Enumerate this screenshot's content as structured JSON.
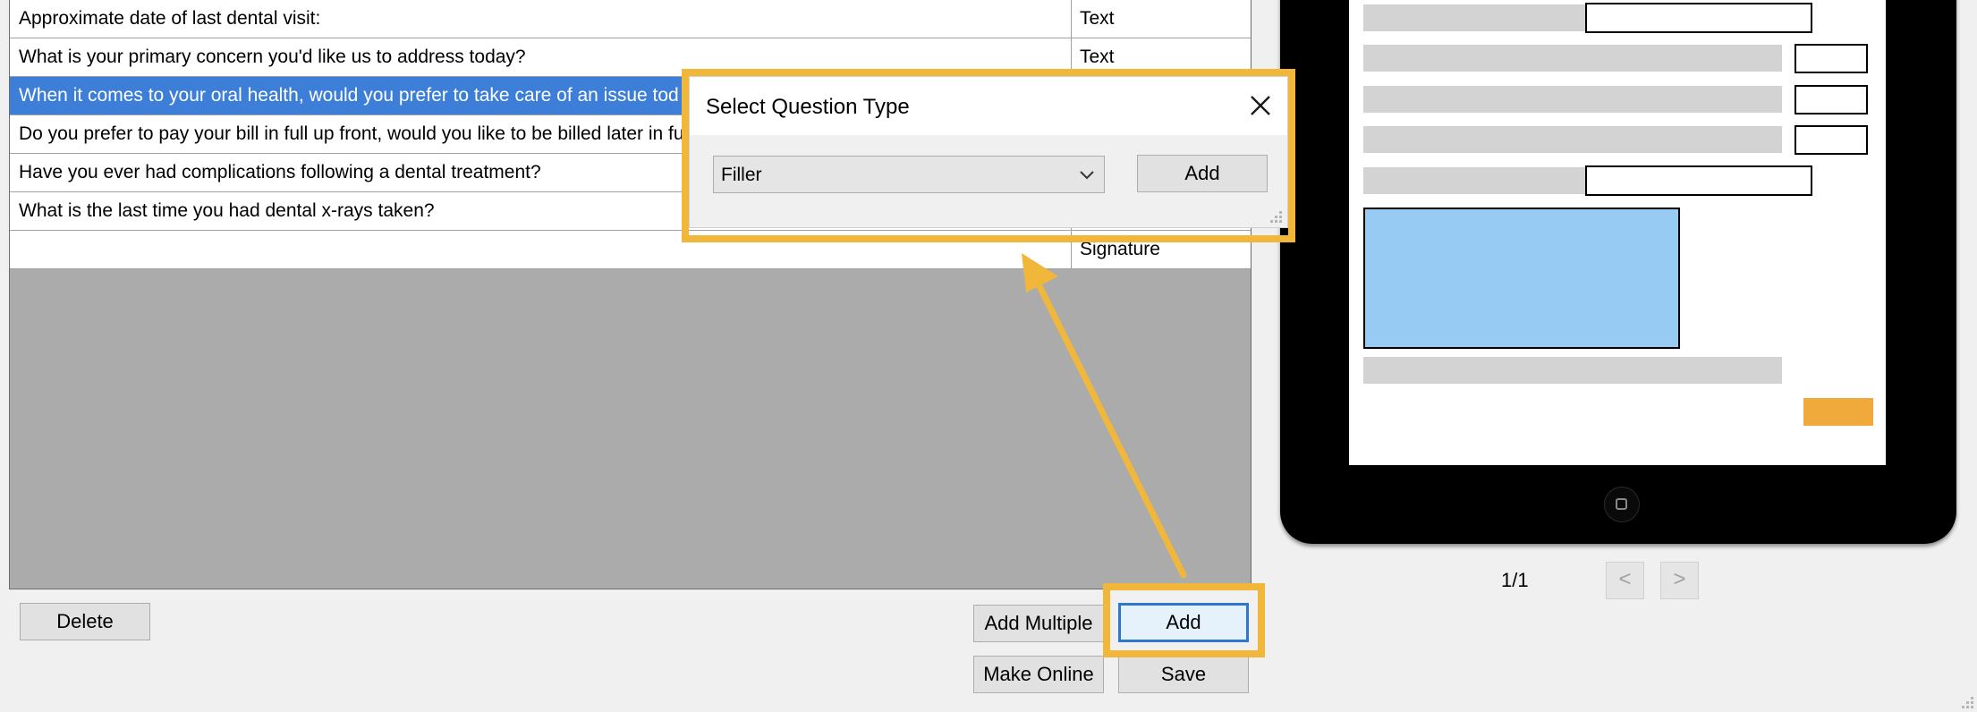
{
  "grid": {
    "rows": [
      {
        "question": "Approximate date of last dental visit:",
        "type": "Text",
        "selected": false
      },
      {
        "question": "What is your primary concern you'd like us to address today?",
        "type": "Text",
        "selected": false
      },
      {
        "question": "When it comes to your oral health, would you prefer to take care of an issue tod",
        "type": "",
        "selected": true
      },
      {
        "question": "Do you prefer to pay your bill in full up front, would you like to be billed later in fu",
        "type": "",
        "selected": false
      },
      {
        "question": "Have you ever had complications following a dental treatment?",
        "type": "",
        "selected": false
      },
      {
        "question": "What is the last time you had dental x-rays taken?",
        "type": "",
        "selected": false
      },
      {
        "question": "",
        "type": "Signature",
        "selected": false
      }
    ]
  },
  "buttons": {
    "delete": "Delete",
    "add_multiple": "Add Multiple",
    "add": "Add",
    "make_online": "Make Online",
    "save": "Save"
  },
  "dialog": {
    "title": "Select Question Type",
    "selected_type": "Filler",
    "add_label": "Add"
  },
  "preview": {
    "page_indicator": "1/1",
    "prev_label": "<",
    "next_label": ">"
  },
  "colors": {
    "highlight": "#f0b73b",
    "selection": "#3d7fd8",
    "preview_signature_box": "#98cbf3",
    "preview_submit": "#f0a93b"
  }
}
